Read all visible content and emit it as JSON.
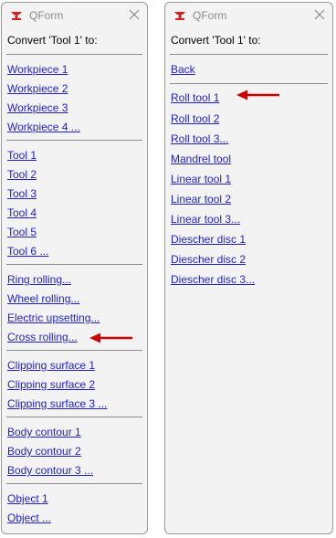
{
  "left": {
    "app_title": "QForm",
    "heading": "Convert 'Tool 1' to:",
    "workpieces": [
      "Workpiece 1",
      "Workpiece 2",
      "Workpiece 3",
      "Workpiece 4 ..."
    ],
    "tools": [
      "Tool 1",
      "Tool 2",
      "Tool 3",
      "Tool 4",
      "Tool 5",
      "Tool 6 ..."
    ],
    "rolling": [
      "Ring rolling...",
      "Wheel rolling...",
      "Electric upsetting...",
      "Cross rolling..."
    ],
    "clipping": [
      "Clipping surface 1",
      "Clipping surface 2",
      "Clipping surface 3 ..."
    ],
    "contours": [
      "Body contour 1",
      "Body contour 2",
      "Body contour 3 ..."
    ],
    "objects": [
      "Object 1",
      "Object ..."
    ]
  },
  "right": {
    "app_title": "QForm",
    "heading": "Convert 'Tool 1' to:",
    "back": "Back",
    "tools": [
      "Roll tool 1",
      "Roll tool 2",
      "Roll tool 3...",
      "Mandrel tool",
      "Linear tool 1",
      "Linear tool 2",
      "Linear tool 3...",
      "Diescher disc 1",
      "Diescher disc 2",
      "Diescher disc 3..."
    ]
  },
  "icons": {
    "app": "qform-anvil-icon",
    "close": "close-icon",
    "pointer": "red-arrow-icon"
  },
  "colors": {
    "link": "#1f1fd0",
    "arrow": "#cc0000",
    "icon_red": "#d32020"
  }
}
